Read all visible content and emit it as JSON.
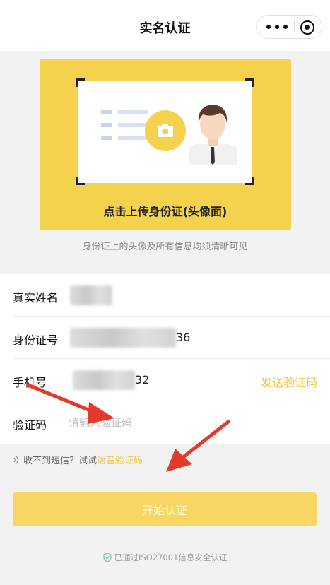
{
  "nav": {
    "title": "实名认证",
    "more_icon": "more-dots-icon",
    "close_icon": "capsule-target-icon"
  },
  "upload": {
    "label": "点击上传身份证(头像面)",
    "camera_icon": "camera-icon",
    "avatar_icon": "person-avatar-icon",
    "hint": "身份证上的头像及所有信息均须清晰可见"
  },
  "form": {
    "name_label": "真实姓名",
    "id_label": "身份证号",
    "id_value_suffix": "36",
    "phone_label": "手机号",
    "phone_value_suffix": "32",
    "send_code": "发送验证码",
    "code_label": "验证码",
    "code_placeholder": "请输入验证码"
  },
  "voice": {
    "prefix": "收不到短信？试试",
    "link": "语音验证码"
  },
  "start_button": "开始认证",
  "footer": "已通过ISO27001信息安全认证",
  "colors": {
    "accent": "#f5d24e",
    "accent_text": "#f0c540",
    "button": "#f7d664",
    "arrow": "#e53a2b"
  }
}
